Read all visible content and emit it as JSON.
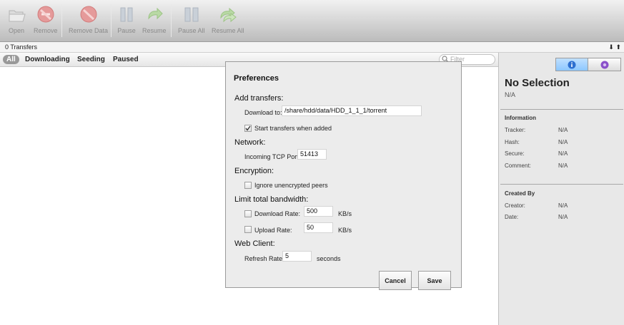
{
  "toolbar": {
    "open": "Open",
    "remove": "Remove",
    "remove_data": "Remove Data",
    "pause": "Pause",
    "resume": "Resume",
    "pause_all": "Pause All",
    "resume_all": "Resume All"
  },
  "statusbar": {
    "transfers": "0 Transfers",
    "speed_icon": "download-arrow-icon"
  },
  "filterbar": {
    "items": [
      "All",
      "Downloading",
      "Seeding",
      "Paused"
    ],
    "active": "All",
    "filter_placeholder": "Filter"
  },
  "inspector": {
    "title": "No Selection",
    "subtitle": "N/A",
    "information_heading": "Information",
    "info_rows": [
      {
        "key": "Tracker:",
        "value": "N/A"
      },
      {
        "key": "Hash:",
        "value": "N/A"
      },
      {
        "key": "Secure:",
        "value": "N/A"
      },
      {
        "key": "Comment:",
        "value": "N/A"
      }
    ],
    "created_heading": "Created By",
    "created_rows": [
      {
        "key": "Creator:",
        "value": "N/A"
      },
      {
        "key": "Date:",
        "value": "N/A"
      }
    ]
  },
  "preferences": {
    "title": "Preferences",
    "add_transfers": "Add transfers:",
    "download_to_label": "Download to:",
    "download_to_value": "/share/hdd/data/HDD_1_1_1/torrent",
    "start_when_added": "Start transfers when added",
    "start_when_added_checked": true,
    "network": "Network:",
    "port_label": "Incoming TCP Port:",
    "port_value": "51413",
    "encryption": "Encryption:",
    "ignore_unencrypted": "Ignore unencrypted peers",
    "ignore_unencrypted_checked": false,
    "limit_bandwidth": "Limit total bandwidth:",
    "download_rate_label": "Download Rate:",
    "download_rate_value": "500",
    "download_rate_unit": "KB/s",
    "download_rate_checked": false,
    "upload_rate_label": "Upload Rate:",
    "upload_rate_value": "50",
    "upload_rate_unit": "KB/s",
    "upload_rate_checked": false,
    "web_client": "Web Client:",
    "refresh_label": "Refresh Rate:",
    "refresh_value": "5",
    "refresh_unit": "seconds",
    "cancel": "Cancel",
    "save": "Save"
  }
}
